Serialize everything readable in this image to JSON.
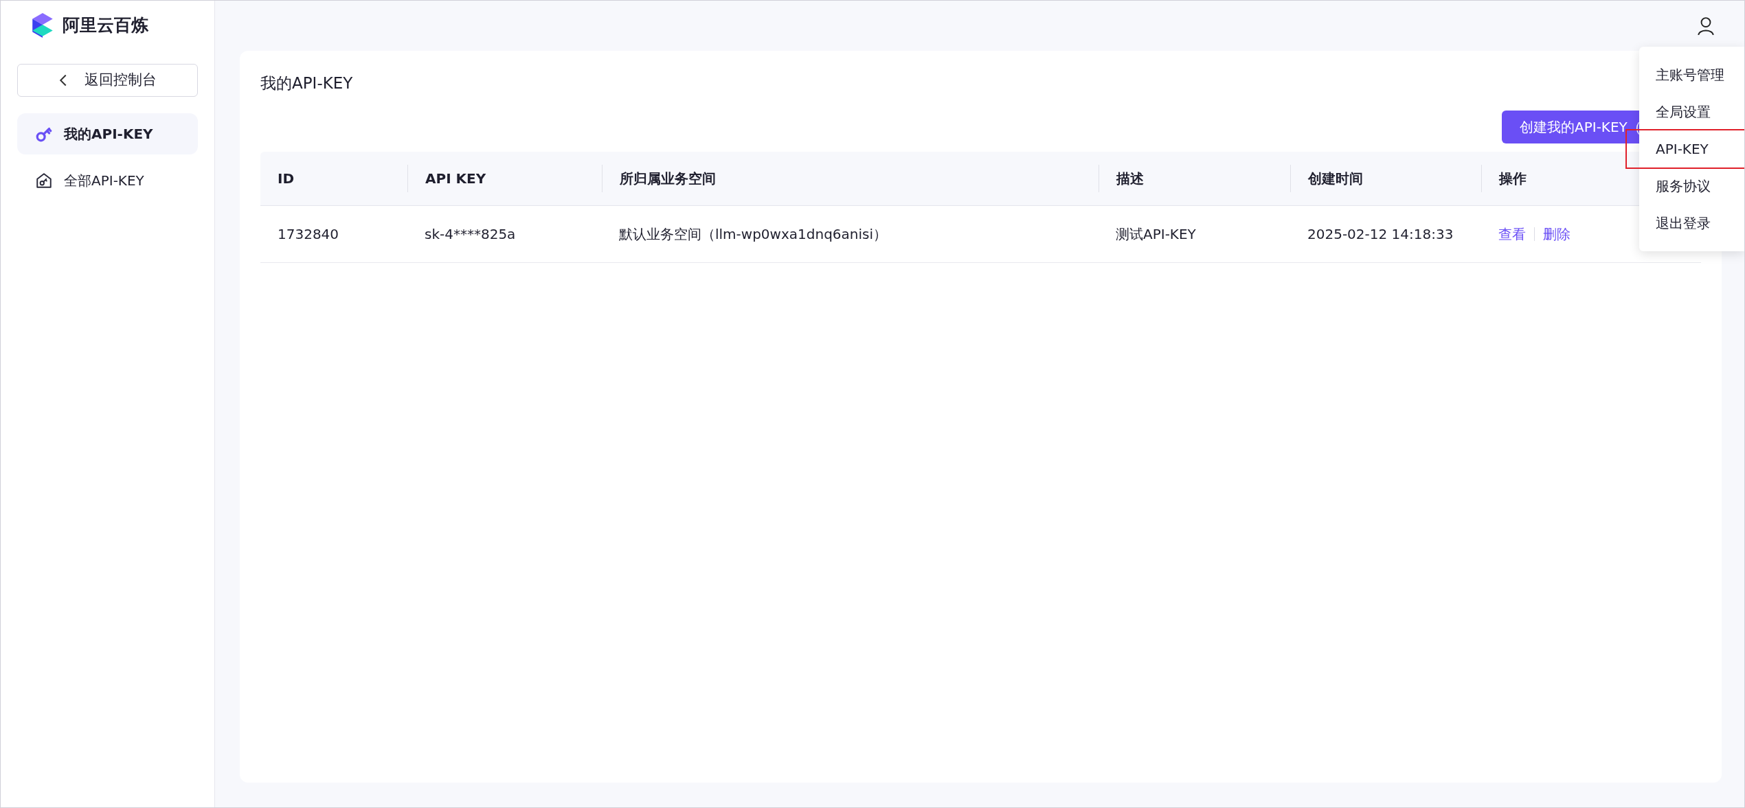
{
  "brand": {
    "name": "阿里云百炼"
  },
  "back_button": {
    "label": "返回控制台"
  },
  "sidebar": {
    "items": [
      {
        "label": "我的API-KEY",
        "selected": true,
        "kind": "key"
      },
      {
        "label": "全部API-KEY",
        "selected": false,
        "kind": "house"
      }
    ]
  },
  "page": {
    "title": "我的API-KEY",
    "create_button": "创建我的API-KEY（"
  },
  "table": {
    "columns": [
      "ID",
      "API KEY",
      "所归属业务空间",
      "描述",
      "创建时间",
      "操作"
    ],
    "rows": [
      {
        "cells": [
          "1732840",
          "sk-4****825a",
          "默认业务空间（llm-wp0wxa1dnq6anisi）",
          "测试API-KEY",
          "2025-02-12 14:18:33"
        ],
        "actions": [
          "查看",
          "删除"
        ]
      }
    ]
  },
  "user_menu": {
    "items": [
      {
        "label": "主账号管理",
        "highlighted": false
      },
      {
        "label": "全局设置",
        "highlighted": false
      },
      {
        "label": "API-KEY",
        "highlighted": true
      },
      {
        "label": "服务协议",
        "highlighted": false
      },
      {
        "label": "退出登录",
        "highlighted": false
      }
    ]
  }
}
